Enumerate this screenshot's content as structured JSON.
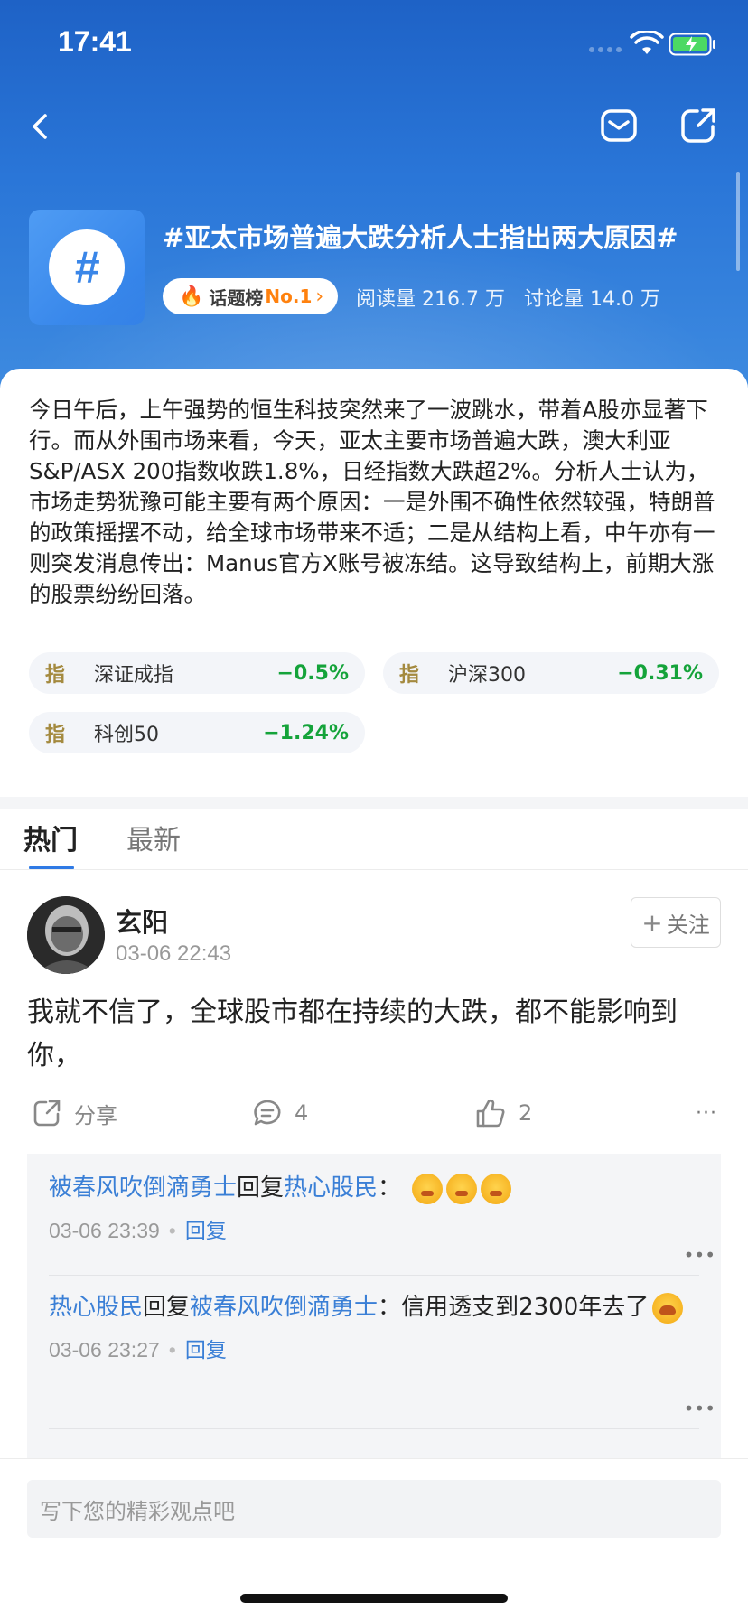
{
  "status_bar": {
    "time": "17:41"
  },
  "header": {
    "back_icon": "chevron-left-icon",
    "mail_icon": "mail-icon",
    "share_icon": "share-external-icon",
    "topic_badge_symbol": "#",
    "topic_title": "#亚太市场普遍大跌分析人士指出两大原因#",
    "rank_label": "话题榜",
    "rank_value": "No.1",
    "read_count": "阅读量 216.7 万",
    "discussion_count": "讨论量 14.0 万"
  },
  "description": "今日午后，上午强势的恒生科技突然来了一波跳水，带着A股亦显著下行。而从外围市场来看，今天，亚太主要市场普遍大跌，澳大利亚S&P/ASX 200指数收跌1.8%，日经指数大跌超2%。分析人士认为，市场走势犹豫可能主要有两个原因：一是外围不确性依然较强，特朗普的政策摇摆不动，给全球市场带来不适；二是从结构上看，中午亦有一则突发消息传出：Manus官方X账号被冻结。这导致结构上，前期大涨的股票纷纷回落。",
  "indices": [
    {
      "tag": "指",
      "name": "深证成指",
      "change": "−0.5%"
    },
    {
      "tag": "指",
      "name": "沪深300",
      "change": "−0.31%"
    },
    {
      "tag": "指",
      "name": "科创50",
      "change": "−1.24%"
    }
  ],
  "colors": {
    "header_blue": "#2a76d8",
    "link_blue": "#3a7fd6",
    "fall_green": "#14a33a",
    "rank_orange": "#ff7a00"
  },
  "tabs": [
    {
      "label": "热门"
    },
    {
      "label": "最新"
    }
  ],
  "post": {
    "user_name": "玄阳",
    "time": "03-06 22:43",
    "follow_label": "关注",
    "text": "我就不信了，全球股市都在持续的大跌，都不能影响到你，",
    "share_label": "分享",
    "comment_count": "4",
    "like_count": "2",
    "more": "···"
  },
  "replies": [
    {
      "from": "被春风吹倒滴勇士",
      "verb": "回复",
      "to": "热心股民",
      "sep": "：",
      "text": "",
      "time": "03-06 23:39",
      "reply_label": "回复"
    },
    {
      "from": "热心股民",
      "verb": "回复",
      "to": "被春风吹倒滴勇士",
      "sep": "：",
      "text": "信用透支到2300年去了",
      "time": "03-06 23:27",
      "reply_label": "回复"
    }
  ],
  "comment_input": {
    "placeholder": "写下您的精彩观点吧"
  }
}
